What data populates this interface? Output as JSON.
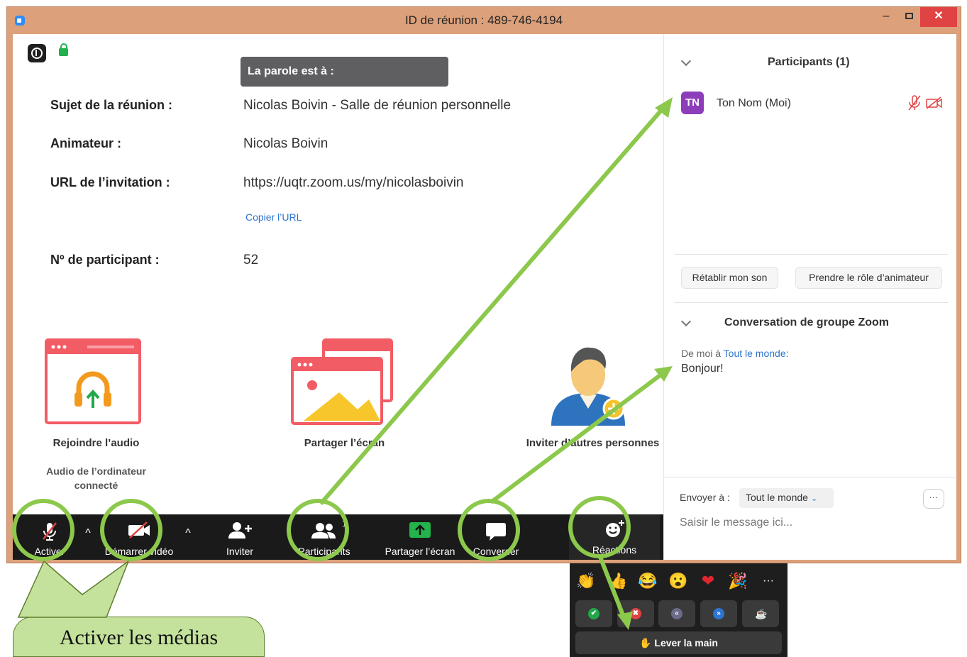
{
  "window": {
    "title": "ID de réunion : 489-746-4194",
    "min_glyph": "–",
    "close_glyph": "✕"
  },
  "speaker": {
    "label": "La parole est à :"
  },
  "meeting_info": {
    "topic_label": "Sujet de la réunion :",
    "topic_value": "Nicolas Boivin - Salle de réunion personnelle",
    "host_label": "Animateur :",
    "host_value": "Nicolas Boivin",
    "url_label": "URL de l’invitation :",
    "url_value": "https://uqtr.zoom.us/my/nicolasboivin",
    "copy_url": "Copier l’URL",
    "participant_id_label": "Nº de participant :",
    "participant_id_value": "52"
  },
  "features": {
    "join_audio": "Rejoindre l’audio",
    "join_audio_sub": "Audio de l’ordinateur connecté",
    "share_screen": "Partager l’écran",
    "invite_others": "Inviter d’autres personnes"
  },
  "toolbar": {
    "unmute": "Activer",
    "start_video": "Démarrer vidéo",
    "invite": "Inviter",
    "participants": "Participants",
    "participants_count": "1",
    "share": "Partager l’écran",
    "chat": "Converser",
    "reactions": "Réactions",
    "caret": "^"
  },
  "participants_panel": {
    "title": "Participants (1)",
    "initials": "TN",
    "name": "Ton Nom (Moi)",
    "unmute_me": "Rétablir mon son",
    "claim_host": "Prendre le rôle d’animateur"
  },
  "chat_panel": {
    "title": "Conversation de groupe Zoom",
    "from": "De moi à",
    "to": "Tout le monde:",
    "message": "Bonjour!",
    "send_to_label": "Envoyer à :",
    "send_to_value": "Tout le monde",
    "dropdown_glyph": "⌄",
    "more": "···",
    "placeholder": "Saisir le message ici..."
  },
  "reactions_popup": {
    "emojis": [
      "👏",
      "👍",
      "😂",
      "😮",
      "❤",
      "🎉",
      "···"
    ],
    "buttons": [
      "✔",
      "✖",
      "«",
      "»",
      "☕"
    ],
    "raise_hand": "✋ Lever la main"
  },
  "callout": {
    "text": "Activer les médias"
  },
  "colors": {
    "window_frame": "#dca07a",
    "toolbar_bg": "#1a1a1a",
    "annotation_green": "#8cc84b",
    "link_blue": "#2d75d0",
    "avatar_purple": "#8b3dba",
    "muted_red": "#e04343",
    "share_green": "#24b24b"
  }
}
